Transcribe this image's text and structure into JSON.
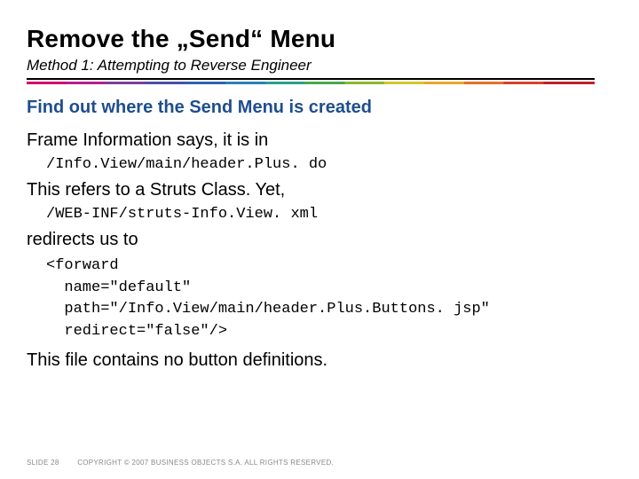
{
  "title": "Remove the „Send“ Menu",
  "subtitle": "Method 1: Attempting to Reverse Engineer",
  "section_head": "Find out where the Send Menu is created",
  "lines": {
    "l1": "Frame Information says, it is in",
    "c1": "/Info.View/main/header.Plus. do",
    "l2": "This refers to a Struts Class. Yet,",
    "c2": "/WEB-INF/struts-Info.View. xml",
    "l3": "redirects us to",
    "c3": "<forward\n  name=\"default\"\n  path=\"/Info.View/main/header.Plus.Buttons. jsp\"\n  redirect=\"false\"/>",
    "l4": "This file contains no button definitions."
  },
  "footer": {
    "slide": "SLIDE 28",
    "copyright": "COPYRIGHT © 2007 BUSINESS OBJECTS S.A. ALL RIGHTS RESERVED."
  }
}
